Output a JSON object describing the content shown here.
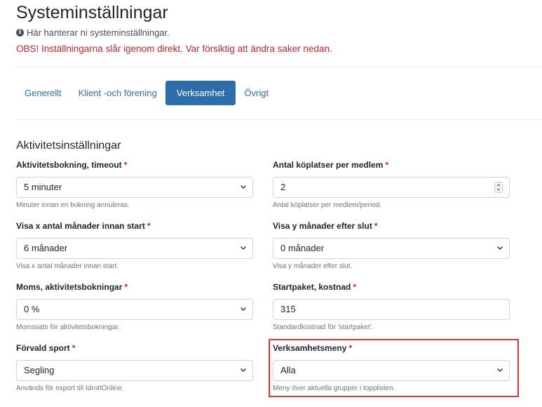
{
  "page": {
    "title": "Systeminställningar",
    "info": "Här hanterar ni systeminställningar.",
    "warning": "OBS! Inställningarna slår igenom direkt. Var försiktig att ändra saker nedan."
  },
  "tabs": [
    {
      "label": "Generellt",
      "active": false
    },
    {
      "label": "Klient -och förening",
      "active": false
    },
    {
      "label": "Verksamhet",
      "active": true
    },
    {
      "label": "Övrigt",
      "active": false
    }
  ],
  "section": {
    "title": "Aktivitetsinställningar"
  },
  "fields": {
    "timeout": {
      "label": "Aktivitetsbokning, timeout",
      "value": "5 minuter",
      "help": "Minuter innan en bokning annuleras."
    },
    "queue": {
      "label": "Antal köplatser per medlem",
      "value": "2",
      "help": "Antal köplatser per medlem/period."
    },
    "months_before": {
      "label": "Visa x antal månader innan start",
      "value": "6 månader",
      "help": "Visa x antal månader innan start."
    },
    "months_after": {
      "label": "Visa y månader efter slut",
      "value": "0 månader",
      "help": "Visa y månader efter slut."
    },
    "vat": {
      "label": "Moms, aktivitetsbokningar",
      "value": "0 %",
      "help": "Momssats för aktivitetsbokningar."
    },
    "starter_cost": {
      "label": "Startpaket, kostnad",
      "value": "315",
      "help": "Standardkostnad för 'startpaket'."
    },
    "sport": {
      "label": "Förvald sport",
      "value": "Segling",
      "help": "Används för export till IdrottOnline."
    },
    "menu": {
      "label": "Verksamhetsmeny",
      "value": "Alla",
      "help": "Meny över aktuella grupper i topplisten."
    }
  },
  "required_marker": "*",
  "colors": {
    "accent": "#2e6dab",
    "warning": "#c0282d",
    "highlight": "#e0363a"
  }
}
